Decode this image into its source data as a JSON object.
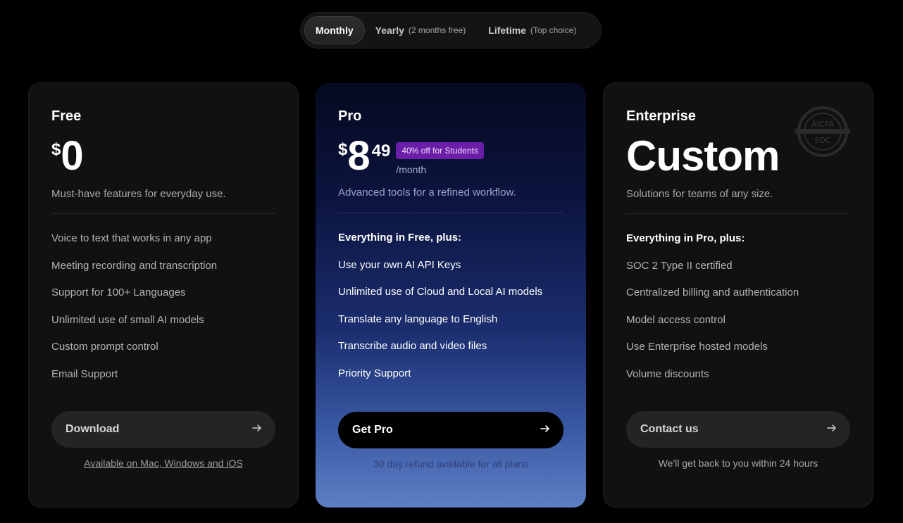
{
  "toggle": {
    "options": [
      {
        "label": "Monthly",
        "note": ""
      },
      {
        "label": "Yearly",
        "note": "(2 months free)"
      },
      {
        "label": "Lifetime",
        "note": "(Top choice)"
      }
    ],
    "active": "Monthly"
  },
  "plans": {
    "free": {
      "name": "Free",
      "currency": "$",
      "amount": "0",
      "tagline": "Must-have features for everyday use.",
      "features": [
        "Voice to text that works in any app",
        "Meeting recording and transcription",
        "Support for 100+ Languages",
        "Unlimited use of small AI models",
        "Custom prompt control",
        "Email Support"
      ],
      "cta": "Download",
      "footnote": "Available on Mac, Windows and iOS"
    },
    "pro": {
      "name": "Pro",
      "currency": "$",
      "amount": "8",
      "cents": "49",
      "badge": "40% off for Students",
      "per": "/month",
      "tagline": "Advanced tools for a refined workflow.",
      "lead": "Everything in Free, plus:",
      "features": [
        "Use your own AI API Keys",
        "Unlimited use of Cloud and Local AI models",
        "Translate any language to English",
        "Transcribe audio and video files",
        "Priority Support"
      ],
      "cta": "Get Pro",
      "footnote": "30 day refund available for all plans"
    },
    "enterprise": {
      "name": "Enterprise",
      "price": "Custom",
      "tagline": "Solutions for teams of any size.",
      "lead": "Everything in Pro, plus:",
      "features": [
        "SOC 2 Type II certified",
        "Centralized billing and authentication",
        "Model access control",
        "Use Enterprise hosted models",
        "Volume discounts"
      ],
      "cta": "Contact us",
      "footnote": "We'll get back to you within 24 hours",
      "seal_top": "AICPA",
      "seal_bottom": "SOC"
    }
  },
  "icons": {
    "cta_arrow": "arrow-right-icon",
    "seal": "aicpa-soc-seal-icon"
  },
  "colors": {
    "background": "#000000",
    "card": "#111111",
    "badge": "#6b1fa8",
    "pro_gradient_top": "#06091f",
    "pro_gradient_bottom": "#5e7ec4"
  }
}
